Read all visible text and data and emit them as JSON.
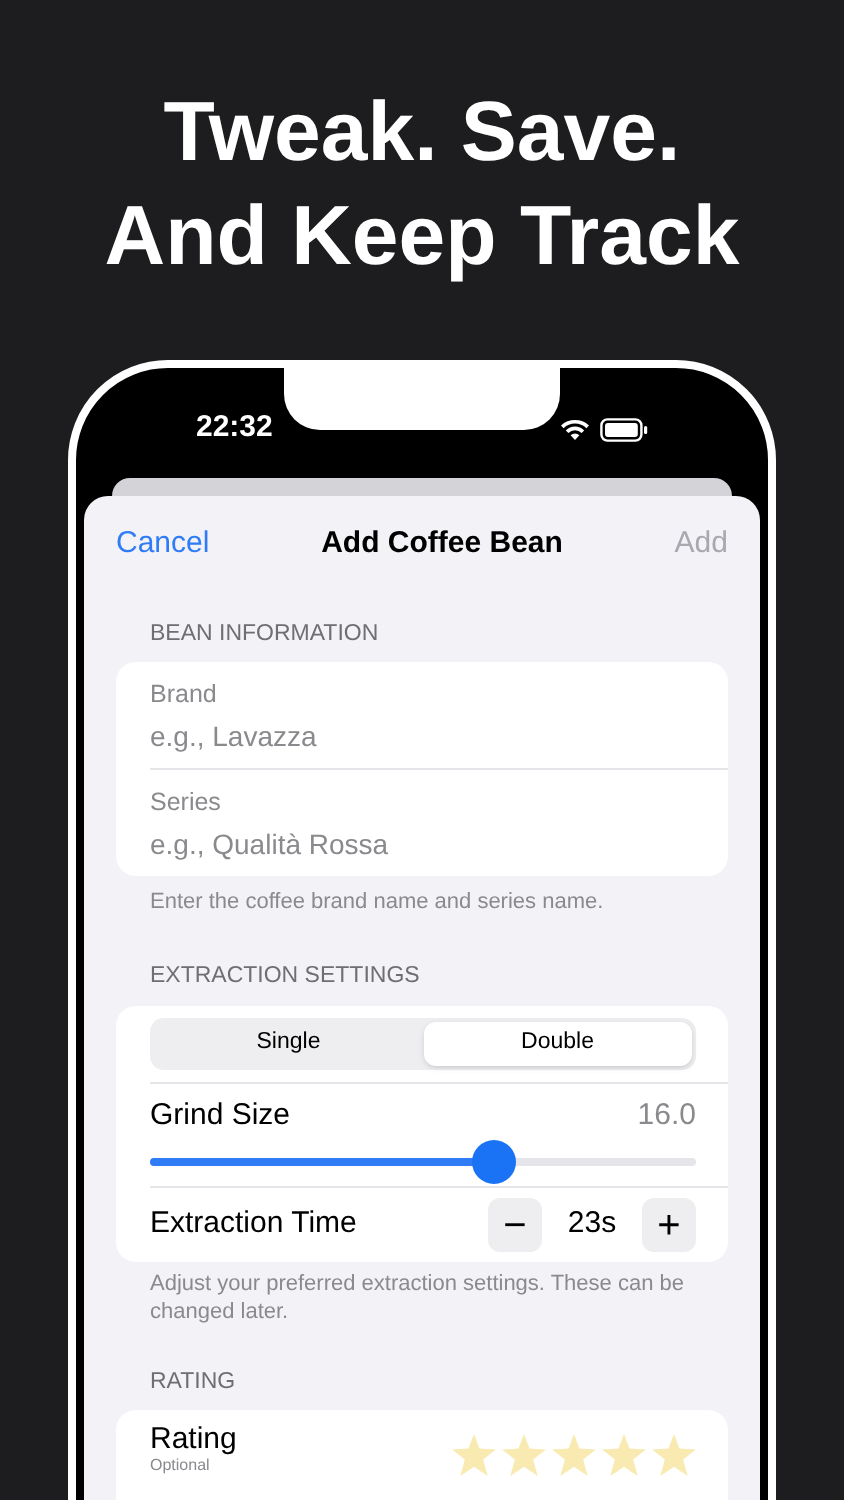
{
  "headline": [
    "Tweak. Save.",
    "And Keep Track"
  ],
  "status_bar": {
    "time": "22:32"
  },
  "nav": {
    "cancel": "Cancel",
    "title": "Add Coffee Bean",
    "add": "Add",
    "add_disabled": true
  },
  "bean_information": {
    "header": "BEAN INFORMATION",
    "fields": [
      {
        "label": "Brand",
        "placeholder": "e.g., Lavazza"
      },
      {
        "label": "Series",
        "placeholder": "e.g., Qualità Rossa"
      }
    ],
    "footer": "Enter the coffee brand name and series name."
  },
  "extraction_settings": {
    "header": "EXTRACTION SETTINGS",
    "segments": [
      {
        "label": "Single",
        "selected": false
      },
      {
        "label": "Double",
        "selected": true
      }
    ],
    "grind_size": {
      "label": "Grind Size",
      "reading": "16.0",
      "level": 0.63
    },
    "extraction_time": {
      "label": "Extraction Time",
      "value": "23s",
      "minus": "−",
      "plus": "+"
    },
    "footer": "Adjust your preferred extraction settings. These can be changed later."
  },
  "rating": {
    "header": "RATING",
    "label": "Rating",
    "hint": "Optional",
    "stars": 5
  }
}
